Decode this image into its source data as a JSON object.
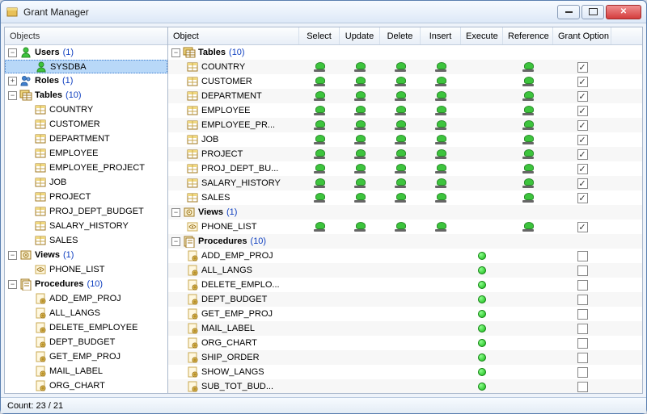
{
  "window": {
    "title": "Grant Manager"
  },
  "left": {
    "header": "Objects",
    "tree": [
      {
        "type": "cat",
        "icon": "user",
        "label": "Users",
        "count": "(1)",
        "exp": "−",
        "depth": 0
      },
      {
        "type": "item",
        "icon": "user",
        "label": "SYSDBA",
        "selected": true,
        "depth": 1
      },
      {
        "type": "cat",
        "icon": "role",
        "label": "Roles",
        "count": "(1)",
        "exp": "+",
        "depth": 0
      },
      {
        "type": "cat",
        "icon": "tables",
        "label": "Tables",
        "count": "(10)",
        "exp": "−",
        "depth": 0
      },
      {
        "type": "item",
        "icon": "table",
        "label": "COUNTRY",
        "depth": 1
      },
      {
        "type": "item",
        "icon": "table",
        "label": "CUSTOMER",
        "depth": 1
      },
      {
        "type": "item",
        "icon": "table",
        "label": "DEPARTMENT",
        "depth": 1
      },
      {
        "type": "item",
        "icon": "table",
        "label": "EMPLOYEE",
        "depth": 1
      },
      {
        "type": "item",
        "icon": "table",
        "label": "EMPLOYEE_PROJECT",
        "depth": 1
      },
      {
        "type": "item",
        "icon": "table",
        "label": "JOB",
        "depth": 1
      },
      {
        "type": "item",
        "icon": "table",
        "label": "PROJECT",
        "depth": 1
      },
      {
        "type": "item",
        "icon": "table",
        "label": "PROJ_DEPT_BUDGET",
        "depth": 1
      },
      {
        "type": "item",
        "icon": "table",
        "label": "SALARY_HISTORY",
        "depth": 1
      },
      {
        "type": "item",
        "icon": "table",
        "label": "SALES",
        "depth": 1
      },
      {
        "type": "cat",
        "icon": "views",
        "label": "Views",
        "count": "(1)",
        "exp": "−",
        "depth": 0
      },
      {
        "type": "item",
        "icon": "view",
        "label": "PHONE_LIST",
        "depth": 1
      },
      {
        "type": "cat",
        "icon": "procs",
        "label": "Procedures",
        "count": "(10)",
        "exp": "−",
        "depth": 0
      },
      {
        "type": "item",
        "icon": "proc",
        "label": "ADD_EMP_PROJ",
        "depth": 1
      },
      {
        "type": "item",
        "icon": "proc",
        "label": "ALL_LANGS",
        "depth": 1
      },
      {
        "type": "item",
        "icon": "proc",
        "label": "DELETE_EMPLOYEE",
        "depth": 1
      },
      {
        "type": "item",
        "icon": "proc",
        "label": "DEPT_BUDGET",
        "depth": 1
      },
      {
        "type": "item",
        "icon": "proc",
        "label": "GET_EMP_PROJ",
        "depth": 1
      },
      {
        "type": "item",
        "icon": "proc",
        "label": "MAIL_LABEL",
        "depth": 1
      },
      {
        "type": "item",
        "icon": "proc",
        "label": "ORG_CHART",
        "depth": 1
      }
    ]
  },
  "right": {
    "headers": {
      "object": "Object",
      "select": "Select",
      "update": "Update",
      "delete": "Delete",
      "insert": "Insert",
      "execute": "Execute",
      "reference": "Reference",
      "grant": "Grant Option"
    },
    "rows": [
      {
        "cat": true,
        "icon": "tables",
        "label": "Tables",
        "count": "(10)",
        "exp": "−"
      },
      {
        "icon": "table",
        "label": "COUNTRY",
        "g": [
          1,
          1,
          1,
          1,
          0,
          1
        ],
        "chk": true
      },
      {
        "icon": "table",
        "label": "CUSTOMER",
        "g": [
          1,
          1,
          1,
          1,
          0,
          1
        ],
        "chk": true
      },
      {
        "icon": "table",
        "label": "DEPARTMENT",
        "g": [
          1,
          1,
          1,
          1,
          0,
          1
        ],
        "chk": true
      },
      {
        "icon": "table",
        "label": "EMPLOYEE",
        "g": [
          1,
          1,
          1,
          1,
          0,
          1
        ],
        "chk": true
      },
      {
        "icon": "table",
        "label": "EMPLOYEE_PR...",
        "g": [
          1,
          1,
          1,
          1,
          0,
          1
        ],
        "chk": true
      },
      {
        "icon": "table",
        "label": "JOB",
        "g": [
          1,
          1,
          1,
          1,
          0,
          1
        ],
        "chk": true
      },
      {
        "icon": "table",
        "label": "PROJECT",
        "g": [
          1,
          1,
          1,
          1,
          0,
          1
        ],
        "chk": true
      },
      {
        "icon": "table",
        "label": "PROJ_DEPT_BU...",
        "g": [
          1,
          1,
          1,
          1,
          0,
          1
        ],
        "chk": true
      },
      {
        "icon": "table",
        "label": "SALARY_HISTORY",
        "g": [
          1,
          1,
          1,
          1,
          0,
          1
        ],
        "chk": true
      },
      {
        "icon": "table",
        "label": "SALES",
        "g": [
          1,
          1,
          1,
          1,
          0,
          1
        ],
        "chk": true
      },
      {
        "cat": true,
        "icon": "views",
        "label": "Views",
        "count": "(1)",
        "exp": "−"
      },
      {
        "icon": "view",
        "label": "PHONE_LIST",
        "g": [
          1,
          1,
          1,
          1,
          0,
          1
        ],
        "chk": true
      },
      {
        "cat": true,
        "icon": "procs",
        "label": "Procedures",
        "count": "(10)",
        "exp": "−"
      },
      {
        "icon": "proc",
        "label": "ADD_EMP_PROJ",
        "g": [
          0,
          0,
          0,
          0,
          2,
          0
        ],
        "chk": false
      },
      {
        "icon": "proc",
        "label": "ALL_LANGS",
        "g": [
          0,
          0,
          0,
          0,
          2,
          0
        ],
        "chk": false
      },
      {
        "icon": "proc",
        "label": "DELETE_EMPLO...",
        "g": [
          0,
          0,
          0,
          0,
          2,
          0
        ],
        "chk": false
      },
      {
        "icon": "proc",
        "label": "DEPT_BUDGET",
        "g": [
          0,
          0,
          0,
          0,
          2,
          0
        ],
        "chk": false
      },
      {
        "icon": "proc",
        "label": "GET_EMP_PROJ",
        "g": [
          0,
          0,
          0,
          0,
          2,
          0
        ],
        "chk": false
      },
      {
        "icon": "proc",
        "label": "MAIL_LABEL",
        "g": [
          0,
          0,
          0,
          0,
          2,
          0
        ],
        "chk": false
      },
      {
        "icon": "proc",
        "label": "ORG_CHART",
        "g": [
          0,
          0,
          0,
          0,
          2,
          0
        ],
        "chk": false
      },
      {
        "icon": "proc",
        "label": "SHIP_ORDER",
        "g": [
          0,
          0,
          0,
          0,
          2,
          0
        ],
        "chk": false
      },
      {
        "icon": "proc",
        "label": "SHOW_LANGS",
        "g": [
          0,
          0,
          0,
          0,
          2,
          0
        ],
        "chk": false
      },
      {
        "icon": "proc",
        "label": "SUB_TOT_BUD...",
        "g": [
          0,
          0,
          0,
          0,
          2,
          0
        ],
        "chk": false
      }
    ]
  },
  "status": "Count: 23 / 21"
}
